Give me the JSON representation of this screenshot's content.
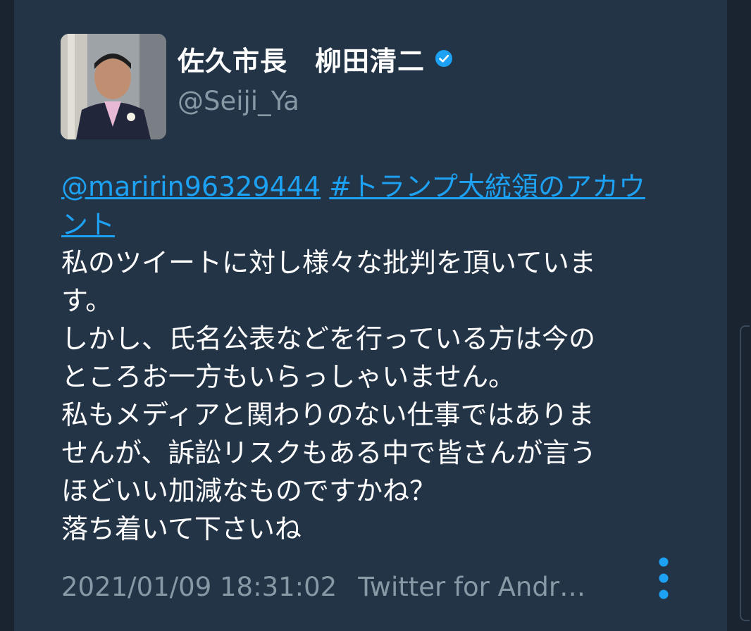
{
  "user": {
    "display_name": "佐久市長　柳田清二",
    "handle": "@Seiji_Ya",
    "verified": true,
    "avatar_icon": "profile-photo"
  },
  "tweet": {
    "mention": "@maririn96329444",
    "hashtag_line1": "#トランプ大統領のアカウ",
    "hashtag_line2": "ント",
    "lines": [
      "私のツイートに対し様々な批判を頂いていま",
      "す。",
      "しかし、氏名公表などを行っている方は今の",
      "ところお一方もいらっしゃいません。",
      "私もメディアと関わりのない仕事ではありま",
      "せんが、訴訟リスクもある中で皆さんが言う",
      "ほどいい加減なものですかね？",
      "落ち着いて下さいね"
    ],
    "timestamp": "2021/01/09 18:31:02",
    "source": "Twitter for Andr…"
  },
  "colors": {
    "background": "#1a2330",
    "card": "#243447",
    "link": "#1da1f2",
    "secondary_text": "#8899a6",
    "primary_text": "#ffffff"
  },
  "icons": {
    "verified": "verified-badge-icon",
    "more": "more-vertical-icon"
  }
}
